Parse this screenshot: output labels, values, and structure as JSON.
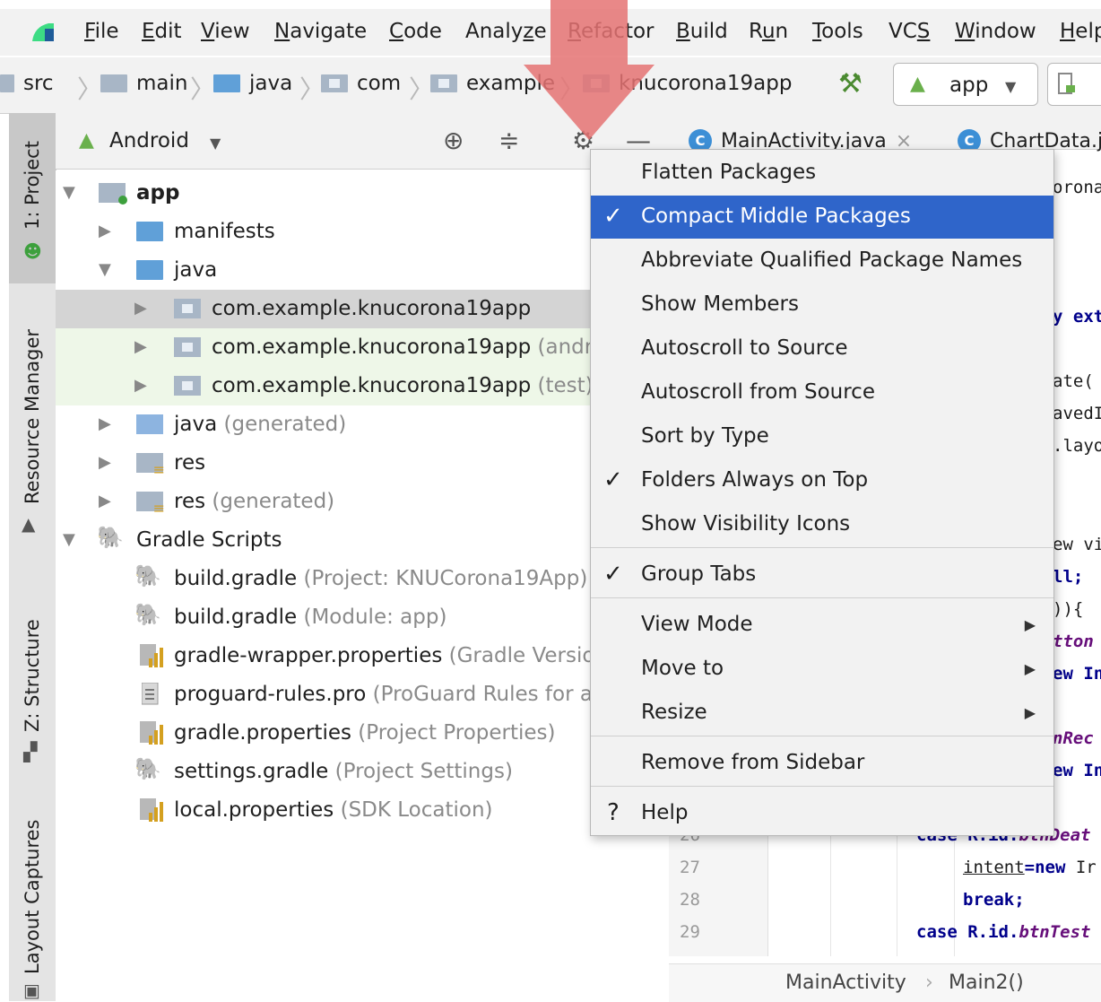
{
  "menubar": {
    "items": [
      {
        "label": "File",
        "mn": "F",
        "rest": "ile"
      },
      {
        "label": "Edit",
        "mn": "E",
        "rest": "dit"
      },
      {
        "label": "View",
        "mn": "V",
        "rest": "iew"
      },
      {
        "label": "Navigate",
        "mn": "N",
        "rest": "avigate"
      },
      {
        "label": "Code",
        "mn": "C",
        "rest": "ode"
      },
      {
        "label": "Analyze",
        "pre": "Analy",
        "mn": "z",
        "rest": "e"
      },
      {
        "label": "Refactor",
        "mn": "R",
        "rest": "efactor"
      },
      {
        "label": "Build",
        "mn": "B",
        "rest": "uild"
      },
      {
        "label": "Run",
        "pre": "R",
        "mn": "u",
        "rest": "n"
      },
      {
        "label": "Tools",
        "mn": "T",
        "rest": "ools"
      },
      {
        "label": "VCS",
        "pre": "VC",
        "mn": "S",
        "rest": ""
      },
      {
        "label": "Window",
        "mn": "W",
        "rest": "indow"
      },
      {
        "label": "Help",
        "mn": "H",
        "rest": "elp"
      }
    ]
  },
  "navbar": {
    "crumbs": [
      "src",
      "main",
      "java",
      "com",
      "example",
      "knucorona19app"
    ],
    "run_config": "app"
  },
  "toolstrip": {
    "project_tab": "1: Project",
    "resource_manager_tab": "Resource Manager",
    "structure_tab": "Z: Structure",
    "layout_captures_tab": "Layout Captures"
  },
  "panel": {
    "view_selector": "Android"
  },
  "tree": {
    "app": "app",
    "manifests": "manifests",
    "java": "java",
    "pkg_main": "com.example.knucorona19app",
    "pkg_android_test": "com.example.knucorona19app",
    "pkg_android_test_hint": "(androidTest)",
    "pkg_test": "com.example.knucorona19app",
    "pkg_test_hint": "(test)",
    "java_generated": "java",
    "java_generated_hint": "(generated)",
    "res": "res",
    "res_generated": "res",
    "res_generated_hint": "(generated)",
    "gradle_scripts": "Gradle Scripts",
    "files": [
      {
        "name": "build.gradle",
        "hint": "(Project: KNUCorona19App)"
      },
      {
        "name": "build.gradle",
        "hint": "(Module: app)"
      },
      {
        "name": "gradle-wrapper.properties",
        "hint": "(Gradle Version)"
      },
      {
        "name": "proguard-rules.pro",
        "hint": "(ProGuard Rules for app)"
      },
      {
        "name": "gradle.properties",
        "hint": "(Project Properties)"
      },
      {
        "name": "settings.gradle",
        "hint": "(Project Settings)"
      },
      {
        "name": "local.properties",
        "hint": "(SDK Location)"
      }
    ]
  },
  "editor": {
    "tabs": [
      "MainActivity.java",
      "ChartData.java"
    ],
    "fragments": {
      "f1": "orona",
      "f2": "y ext",
      "f3": "ate(",
      "f4": "avedI",
      "f5": ".layo",
      "f6": "ew vi",
      "f7": "ll;",
      "f8": ")){",
      "f9": "tton",
      "f10": "ew In",
      "f11": "nRec",
      "f12": "ew In"
    },
    "lines": [
      {
        "num": "26",
        "pre": "case R.id.",
        "it": "btnDeat"
      },
      {
        "num": "27",
        "pre": "intent",
        "kw": "=new",
        "rest": " Ir"
      },
      {
        "num": "28",
        "kw": "break;"
      },
      {
        "num": "29",
        "pre": "case R.id.",
        "it": "btnTest"
      }
    ],
    "breadcrumb": [
      "MainActivity",
      "Main2()"
    ]
  },
  "popup": {
    "items": [
      {
        "label": "Flatten Packages",
        "checked": false
      },
      {
        "label": "Compact Middle Packages",
        "checked": true
      },
      {
        "label": "Abbreviate Qualified Package Names",
        "checked": false
      },
      {
        "label": "Show Members",
        "checked": false
      },
      {
        "label": "Autoscroll to Source",
        "checked": false
      },
      {
        "label": "Autoscroll from Source",
        "checked": false
      },
      {
        "label": "Sort by Type",
        "checked": false
      },
      {
        "label": "Folders Always on Top",
        "checked": true
      },
      {
        "label": "Show Visibility Icons",
        "checked": false
      },
      {
        "label": "Group Tabs",
        "checked": true
      },
      {
        "label": "View Mode",
        "submenu": true
      },
      {
        "label": "Move to",
        "submenu": true
      },
      {
        "label": "Resize",
        "submenu": true
      },
      {
        "label": "Remove from Sidebar"
      },
      {
        "label": "Help"
      }
    ],
    "check_glyph": "✓",
    "help_glyph": "?",
    "submenu_glyph": "▶"
  },
  "colors": {
    "highlight": "#2f65ca",
    "overlay_arrow": "#e57373",
    "android_green": "#6ab04c"
  }
}
